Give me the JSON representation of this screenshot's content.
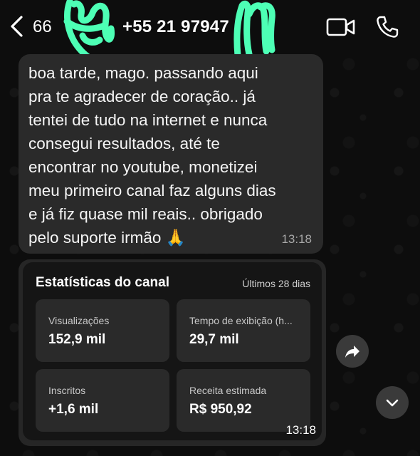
{
  "header": {
    "unread_count": "66",
    "contact_name": "+55 21 97947",
    "back_icon": "chevron-left-icon",
    "video_icon": "video-camera-icon",
    "call_icon": "phone-icon"
  },
  "messages": [
    {
      "text": "boa tarde, mago. passando aqui\npra te agradecer de coração.. já\ntentei de tudo na internet e nunca\nconsegui resultados, até te\nencontrar no youtube, monetizei\nmeu primeiro canal faz alguns dias\ne já fiz quase mil reais.. obrigado\npelo suporte irmão 🙏",
      "time": "13:18"
    },
    {
      "card": {
        "title": "Estatísticas do canal",
        "period": "Últimos 28 dias",
        "stats": [
          {
            "label": "Visualizações",
            "value": "152,9 mil"
          },
          {
            "label": "Tempo de exibição (h...",
            "value": "29,7 mil"
          },
          {
            "label": "Inscritos",
            "value": "+1,6 mil"
          },
          {
            "label": "Receita estimada",
            "value": "R$ 950,92"
          }
        ]
      },
      "time": "13:18"
    }
  ],
  "colors": {
    "background": "#0d0d0d",
    "bubble": "#2a2a2a",
    "scribble": "#4dffb5"
  }
}
